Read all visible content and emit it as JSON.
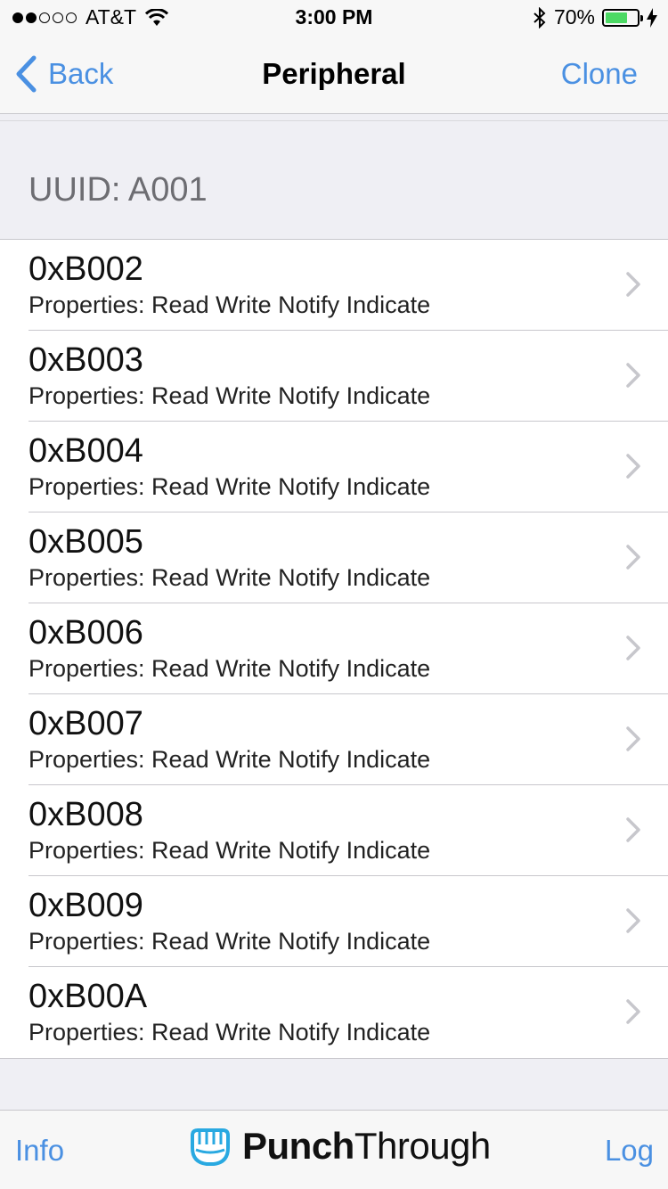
{
  "status_bar": {
    "carrier": "AT&T",
    "time": "3:00 PM",
    "battery": "70%",
    "battery_level": 0.7
  },
  "nav": {
    "back_label": "Back",
    "title": "Peripheral",
    "clone_label": "Clone"
  },
  "section": {
    "header": "UUID: A001"
  },
  "characteristics": [
    {
      "uuid": "0xB002",
      "properties": "Properties: Read Write Notify Indicate"
    },
    {
      "uuid": "0xB003",
      "properties": "Properties: Read Write Notify Indicate"
    },
    {
      "uuid": "0xB004",
      "properties": "Properties: Read Write Notify Indicate"
    },
    {
      "uuid": "0xB005",
      "properties": "Properties: Read Write Notify Indicate"
    },
    {
      "uuid": "0xB006",
      "properties": "Properties: Read Write Notify Indicate"
    },
    {
      "uuid": "0xB007",
      "properties": "Properties: Read Write Notify Indicate"
    },
    {
      "uuid": "0xB008",
      "properties": "Properties: Read Write Notify Indicate"
    },
    {
      "uuid": "0xB009",
      "properties": "Properties: Read Write Notify Indicate"
    },
    {
      "uuid": "0xB00A",
      "properties": "Properties: Read Write Notify Indicate"
    }
  ],
  "tabbar": {
    "info_label": "Info",
    "log_label": "Log",
    "logo_bold": "Punch",
    "logo_regular": "Through"
  },
  "colors": {
    "accent": "#4a90e2",
    "battery": "#4cd964"
  }
}
